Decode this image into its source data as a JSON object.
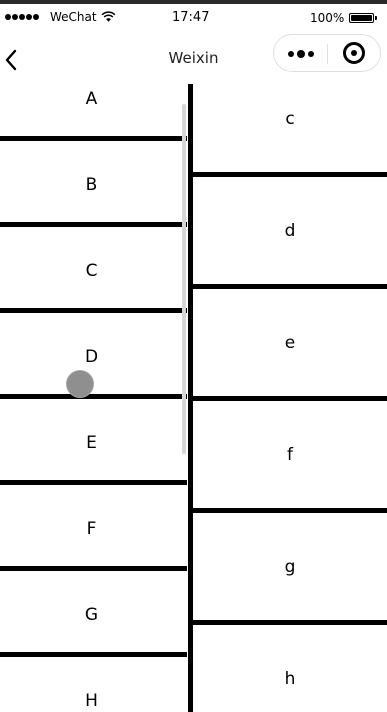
{
  "status_bar": {
    "carrier": "WeChat",
    "time": "17:47",
    "battery_percent": "100%",
    "battery_level": 1.0
  },
  "nav": {
    "title": "Weixin",
    "back_icon": "back-chevron-icon",
    "more_icon": "more-dots-icon",
    "close_icon": "close-target-icon"
  },
  "left_list": [
    "A",
    "B",
    "C",
    "D",
    "E",
    "F",
    "G",
    "H"
  ],
  "right_list": [
    "c",
    "d",
    "e",
    "f",
    "g",
    "h"
  ]
}
